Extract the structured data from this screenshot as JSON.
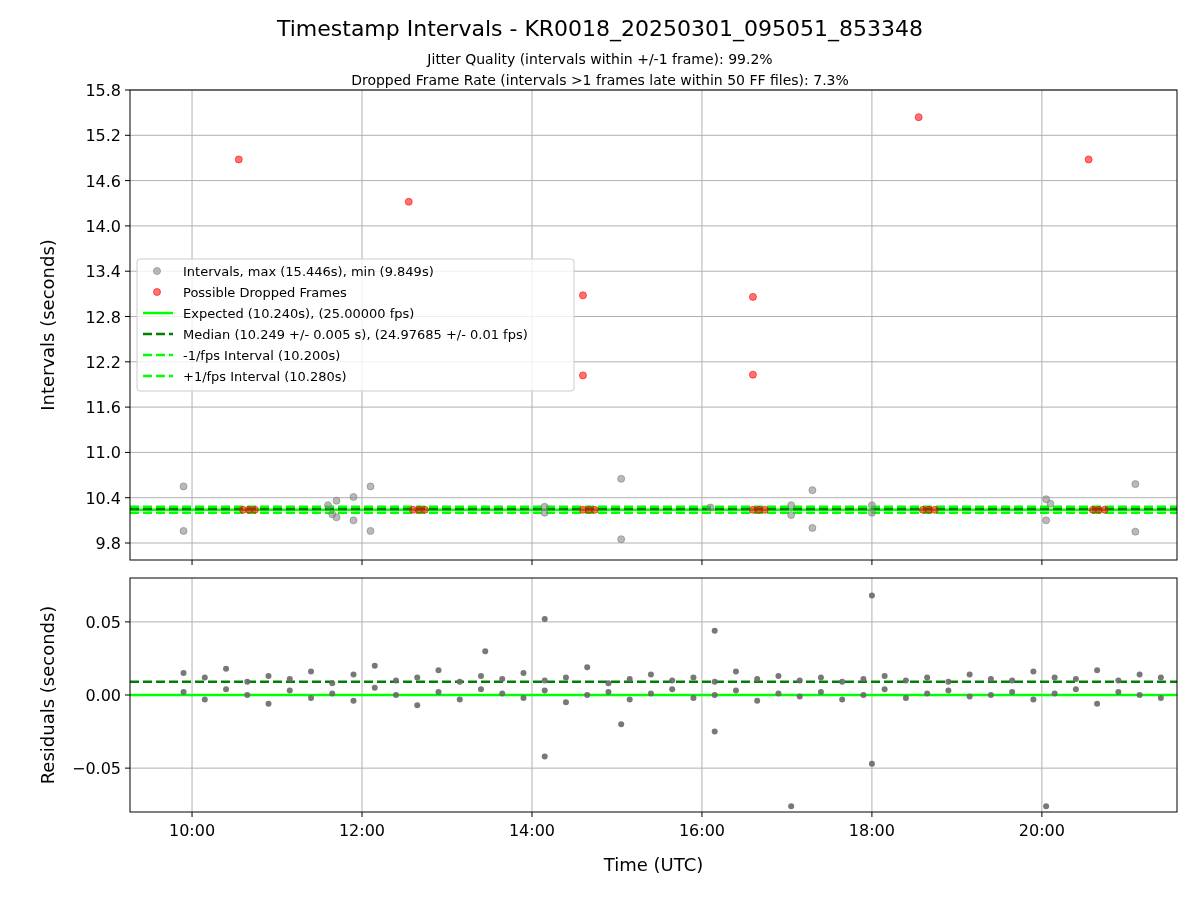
{
  "figure": {
    "title": "Timestamp Intervals - KR0018_20250301_095051_853348",
    "subtitles": [
      "Jitter Quality (intervals within +/-1 frame): 99.2%",
      "Dropped Frame Rate (intervals >1 frames late within 50 FF files): 7.3%"
    ]
  },
  "plots": [
    {
      "chart_data": {
        "type": "scatter",
        "ylabel": "Intervals (seconds)",
        "xlim": [
          9.27,
          21.59
        ],
        "ylim": [
          9.575,
          15.8
        ],
        "grid": true,
        "legend": true,
        "yticks": [
          {
            "value": 9.8,
            "label": "9.8"
          },
          {
            "value": 10.4,
            "label": "10.4"
          },
          {
            "value": 11.0,
            "label": "11.0"
          },
          {
            "value": 11.6,
            "label": "11.6"
          },
          {
            "value": 12.2,
            "label": "12.2"
          },
          {
            "value": 12.8,
            "label": "12.8"
          },
          {
            "value": 13.4,
            "label": "13.4"
          },
          {
            "value": 14.0,
            "label": "14.0"
          },
          {
            "value": 14.6,
            "label": "14.6"
          },
          {
            "value": 15.2,
            "label": "15.2"
          },
          {
            "value": 15.8,
            "label": "15.8"
          }
        ],
        "series": [
          {
            "name": "Intervals, max (15.446s), min (9.849s)",
            "type": "scatter",
            "color": "#808080",
            "x": [
              9.9,
              9.9,
              11.6,
              11.65,
              11.7,
              11.7,
              11.9,
              11.9,
              12.1,
              12.1,
              14.15,
              14.15,
              15.05,
              15.05,
              16.1,
              17.05,
              17.05,
              17.3,
              17.3,
              18.0,
              18.0,
              20.05,
              20.05,
              20.1,
              21.1,
              21.1
            ],
            "values": [
              10.55,
              9.96,
              10.3,
              10.18,
              10.36,
              10.14,
              10.41,
              10.1,
              10.55,
              9.96,
              10.28,
              10.2,
              10.65,
              9.85,
              10.27,
              10.3,
              10.17,
              10.5,
              10.0,
              10.3,
              10.2,
              10.38,
              10.1,
              10.32,
              10.58,
              9.95
            ]
          },
          {
            "name": "Possible Dropped Frames",
            "type": "scatter",
            "color": "#ff0000",
            "x": [
              10.55,
              12.55,
              14.6,
              14.6,
              16.6,
              16.6,
              18.55,
              20.55,
              10.6,
              10.67,
              10.74,
              12.6,
              12.67,
              12.74,
              14.6,
              14.67,
              14.74,
              16.6,
              16.67,
              16.74,
              18.6,
              18.67,
              18.74,
              20.6,
              20.67,
              20.74
            ],
            "values": [
              14.88,
              14.32,
              13.08,
              12.02,
              13.06,
              12.03,
              15.44,
              14.88,
              10.24,
              10.24,
              10.24,
              10.24,
              10.24,
              10.24,
              10.24,
              10.24,
              10.24,
              10.24,
              10.24,
              10.24,
              10.24,
              10.24,
              10.24,
              10.24,
              10.24,
              10.24
            ]
          },
          {
            "name": "Expected (10.240s), (25.00000 fps)",
            "type": "line",
            "color": "#00ff00",
            "x": [
              9.27,
              21.59
            ],
            "values": [
              10.24,
              10.24
            ]
          },
          {
            "name": "Median (10.249 +/- 0.005 s), (24.97685 +/- 0.01 fps)",
            "type": "line",
            "line_style": "dashed",
            "color": "#008000",
            "x": [
              9.27,
              21.59
            ],
            "values": [
              10.25,
              10.25
            ]
          },
          {
            "name": "-1/fps Interval (10.200s)",
            "type": "line",
            "line_style": "dashed",
            "color": "#00ff00",
            "x": [
              9.27,
              21.59
            ],
            "values": [
              10.2,
              10.2
            ]
          },
          {
            "name": "+1/fps Interval (10.280s)",
            "type": "line",
            "line_style": "dashed",
            "color": "#00ff00",
            "x": [
              9.27,
              21.59
            ],
            "values": [
              10.28,
              10.28
            ]
          }
        ]
      }
    },
    {
      "chart_data": {
        "type": "scatter",
        "xlabel": "Time (UTC)",
        "ylabel": "Residuals (seconds)",
        "xlim": [
          9.27,
          21.59
        ],
        "ylim": [
          -0.08,
          0.08
        ],
        "grid": true,
        "xticks": [
          {
            "value": 10,
            "label": "10:00"
          },
          {
            "value": 12,
            "label": "12:00"
          },
          {
            "value": 14,
            "label": "14:00"
          },
          {
            "value": 16,
            "label": "16:00"
          },
          {
            "value": 18,
            "label": "18:00"
          },
          {
            "value": 20,
            "label": "20:00"
          }
        ],
        "yticks": [
          {
            "value": 0.05,
            "label": "0.05"
          },
          {
            "value": 0,
            "label": "0.00"
          },
          {
            "value": -0.05,
            "label": "−0.05"
          }
        ],
        "series": [
          {
            "type": "scatter",
            "color": "#696969",
            "x": [
              9.9,
              10.15,
              10.4,
              10.65,
              10.9,
              11.15,
              11.4,
              11.65,
              11.9,
              12.15,
              12.4,
              12.65,
              12.9,
              13.15,
              13.4,
              13.65,
              13.9,
              14.15,
              14.4,
              14.65,
              14.9,
              15.15,
              15.4,
              15.65,
              15.9,
              16.15,
              16.4,
              16.65,
              16.9,
              17.15,
              17.4,
              17.65,
              17.9,
              18.15,
              18.4,
              18.65,
              18.9,
              19.15,
              19.4,
              19.65,
              19.9,
              20.15,
              20.4,
              20.65,
              20.9,
              21.15,
              21.4
            ],
            "values": [
              0.015,
              0.012,
              0.018,
              0.009,
              0.013,
              0.011,
              0.016,
              0.008,
              0.014,
              0.02,
              0.01,
              0.012,
              0.017,
              0.009,
              0.013,
              0.011,
              0.015,
              0.01,
              0.012,
              0.019,
              0.008,
              0.011,
              0.014,
              0.01,
              0.012,
              0.009,
              0.016,
              0.011,
              0.013,
              0.01,
              0.012,
              0.009,
              0.011,
              0.013,
              0.01,
              0.012,
              0.009,
              0.014,
              0.011,
              0.01,
              0.016,
              0.012,
              0.011,
              0.017,
              0.01,
              0.014,
              0.012
            ]
          },
          {
            "type": "scatter",
            "color": "#696969",
            "x": [
              9.9,
              10.15,
              10.4,
              10.65,
              10.9,
              11.15,
              11.4,
              11.65,
              11.9,
              12.15,
              12.4,
              12.65,
              12.9,
              13.15,
              13.4,
              13.65,
              13.9,
              14.15,
              14.4,
              14.65,
              14.9,
              15.15,
              15.4,
              15.65,
              15.9,
              16.15,
              16.4,
              16.65,
              16.9,
              17.15,
              17.4,
              17.65,
              17.9,
              18.15,
              18.4,
              18.65,
              18.9,
              19.15,
              19.4,
              19.65,
              19.9,
              20.15,
              20.4,
              20.65,
              20.9,
              21.15,
              21.4
            ],
            "values": [
              0.002,
              -0.003,
              0.004,
              0.0,
              -0.006,
              0.003,
              -0.002,
              0.001,
              -0.004,
              0.005,
              0.0,
              -0.007,
              0.002,
              -0.003,
              0.004,
              0.001,
              -0.002,
              0.003,
              -0.005,
              0.0,
              0.002,
              -0.003,
              0.001,
              0.004,
              -0.002,
              0.0,
              0.003,
              -0.004,
              0.001,
              -0.001,
              0.002,
              -0.003,
              0.0,
              0.004,
              -0.002,
              0.001,
              0.003,
              -0.001,
              0.0,
              0.002,
              -0.003,
              0.001,
              0.004,
              -0.006,
              0.002,
              0.0,
              -0.002
            ]
          },
          {
            "type": "scatter",
            "color": "#696969",
            "x": [
              13.45,
              14.15,
              14.15,
              15.05,
              16.15,
              16.15,
              17.05,
              18.0,
              18.0,
              20.05
            ],
            "values": [
              0.03,
              0.052,
              -0.042,
              -0.02,
              0.044,
              -0.025,
              -0.076,
              0.068,
              -0.047,
              -0.076
            ]
          },
          {
            "type": "line",
            "line_style": "dashed",
            "color": "#008000",
            "x": [
              9.27,
              21.59
            ],
            "values": [
              0.009,
              0.009
            ]
          },
          {
            "type": "line",
            "color": "#00ff00",
            "x": [
              9.27,
              21.59
            ],
            "values": [
              0,
              0
            ]
          }
        ]
      }
    }
  ]
}
